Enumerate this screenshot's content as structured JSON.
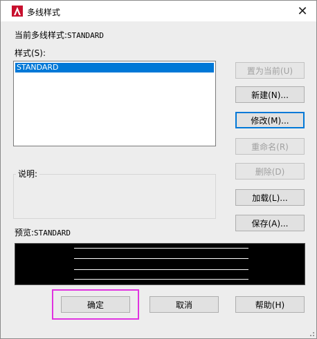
{
  "window": {
    "title": "多线样式"
  },
  "current_style": {
    "label": "当前多线样式:",
    "value": "STANDARD"
  },
  "styles_list": {
    "label": "样式(S):",
    "items": [
      "STANDARD"
    ]
  },
  "description": {
    "label": "说明:"
  },
  "preview": {
    "label": "预览:",
    "style_name": "STANDARD"
  },
  "buttons": {
    "set_current": "置为当前(U)",
    "new": "新建(N)...",
    "modify": "修改(M)...",
    "rename": "重命名(R)",
    "delete": "删除(D)",
    "load": "加载(L)...",
    "save": "保存(A)...",
    "ok": "确定",
    "cancel": "取消",
    "help": "帮助(H)"
  },
  "colors": {
    "selection": "#0078d7",
    "highlight_box": "#e033e0",
    "logo": "#c8102e",
    "preview_bg": "#000000"
  }
}
